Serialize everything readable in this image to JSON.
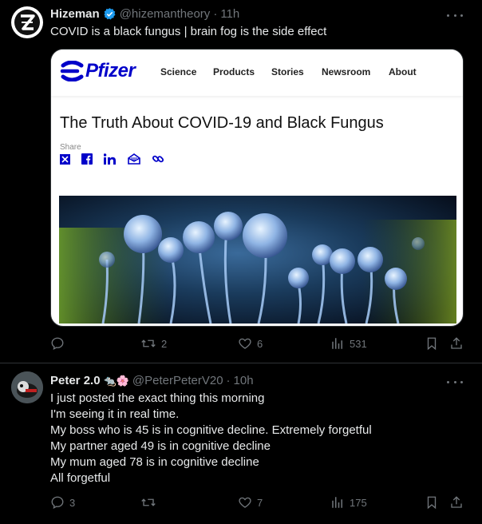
{
  "tweets": [
    {
      "author_name": "Hizeman",
      "handle": "@hizemantheory",
      "separator": "·",
      "time": "11h",
      "text": "COVID is a black fungus | brain fog is the side effect",
      "card": {
        "logo_text": "Pfizer",
        "nav": [
          "Science",
          "Products",
          "Stories",
          "Newsroom",
          "About"
        ],
        "article_title": "The Truth About COVID-19 and Black Fungus",
        "share_label": "Share"
      },
      "stats": {
        "replies": "",
        "retweets": "2",
        "likes": "6",
        "views": "531"
      }
    },
    {
      "author_name": "Peter 2.0",
      "name_emojis": "🐀🌸",
      "handle": "@PeterPeterV20",
      "separator": "·",
      "time": "10h",
      "lines": [
        "I just posted the exact thing this morning",
        "I'm seeing it in real time.",
        "My boss who is 45 is in cognitive decline. Extremely forgetful",
        "My partner aged 49 is in cognitive decline",
        "My mum aged 78 is in cognitive decline",
        "All forgetful"
      ],
      "stats": {
        "replies": "3",
        "retweets": "",
        "likes": "7",
        "views": "175"
      }
    }
  ],
  "colors": {
    "background": "#000000",
    "text": "#e7e9ea",
    "muted": "#71767b",
    "verified": "#1d9bf0",
    "pfizer_blue": "#0000c9"
  },
  "icons": [
    "reply-icon",
    "retweet-icon",
    "like-icon",
    "views-icon",
    "bookmark-icon",
    "share-icon",
    "more-icon",
    "verified-badge-icon"
  ]
}
